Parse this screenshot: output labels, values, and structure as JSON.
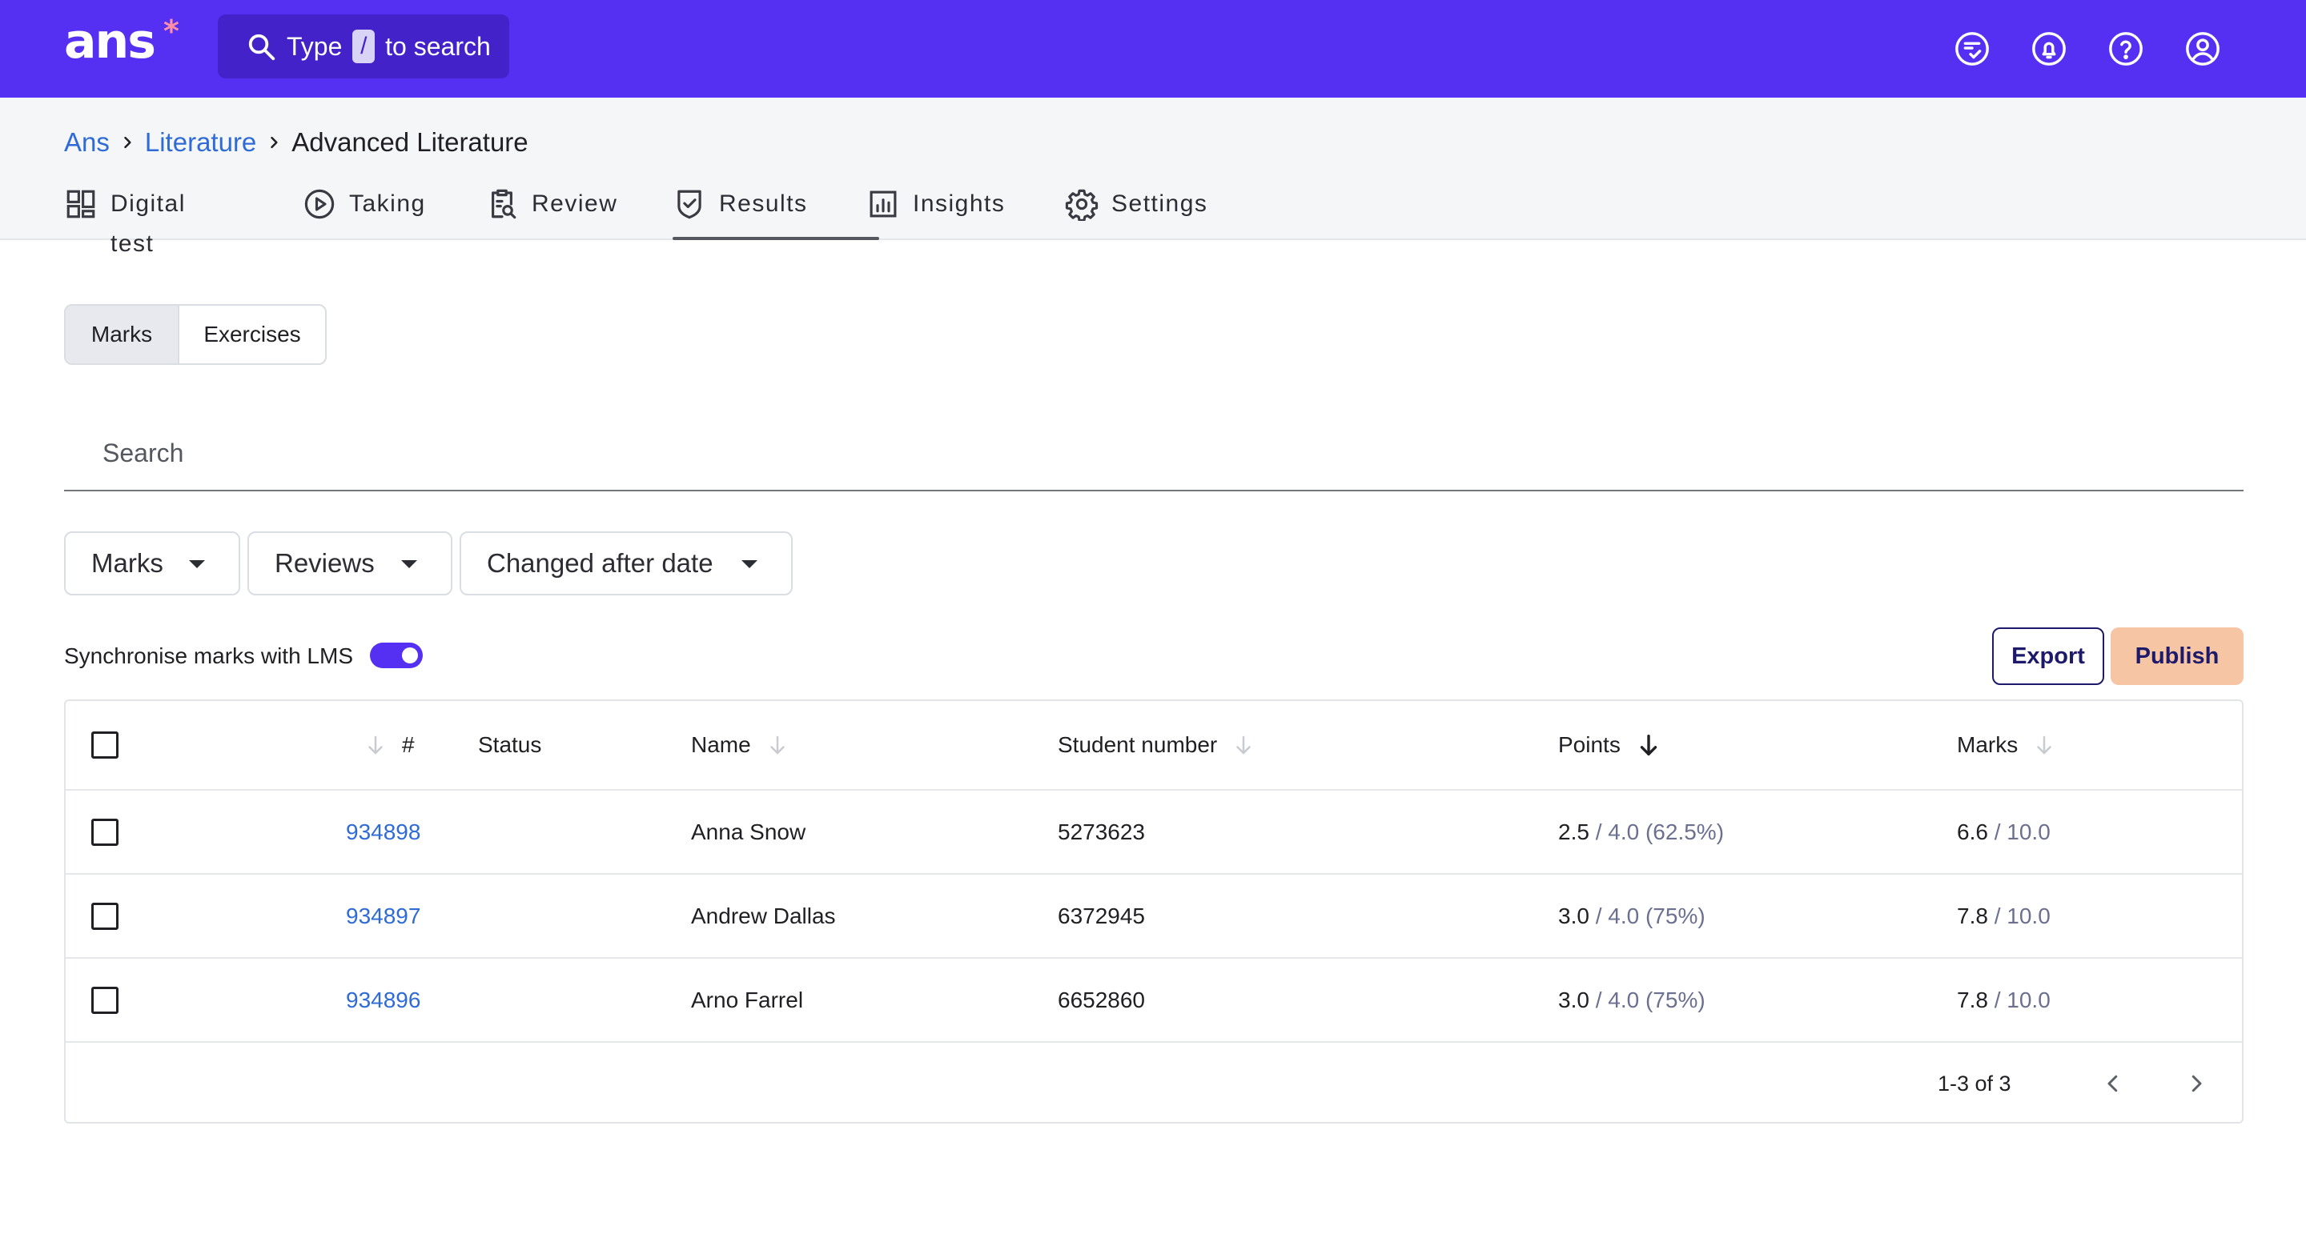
{
  "header": {
    "logo_text": "ans",
    "logo_mark": "*",
    "search": {
      "prefix": "Type",
      "key": "/",
      "suffix": "to search"
    },
    "icons": [
      "reviews-icon",
      "notifications-icon",
      "help-icon",
      "account-icon"
    ]
  },
  "breadcrumb": {
    "root": "Ans",
    "parent": "Literature",
    "current": "Advanced Literature"
  },
  "tabs": [
    {
      "label": "Digital test",
      "icon": "dashboard-icon"
    },
    {
      "label": "Taking",
      "icon": "play-circle-icon"
    },
    {
      "label": "Review",
      "icon": "clipboard-search-icon"
    },
    {
      "label": "Results",
      "icon": "shield-check-icon",
      "active": true
    },
    {
      "label": "Insights",
      "icon": "bar-chart-icon"
    },
    {
      "label": "Settings",
      "icon": "gear-icon"
    }
  ],
  "segment": {
    "active": "Marks",
    "other": "Exercises"
  },
  "search": {
    "placeholder": "Search"
  },
  "filters": [
    "Marks",
    "Reviews",
    "Changed after date"
  ],
  "sync": {
    "label": "Synchronise marks with LMS",
    "enabled": true
  },
  "actions": {
    "export": "Export",
    "publish": "Publish"
  },
  "table": {
    "columns": {
      "id": "#",
      "status": "Status",
      "name": "Name",
      "student_number": "Student number",
      "points": "Points",
      "marks": "Marks"
    },
    "rows": [
      {
        "id": "934898",
        "status": "",
        "name": "Anna Snow",
        "student_number": "5273623",
        "points": "2.5",
        "points_total": "/ 4.0 (62.5%)",
        "mark": "6.6",
        "mark_total": "/ 10.0"
      },
      {
        "id": "934897",
        "status": "",
        "name": "Andrew Dallas",
        "student_number": "6372945",
        "points": "3.0",
        "points_total": "/ 4.0 (75%)",
        "mark": "7.8",
        "mark_total": "/ 10.0"
      },
      {
        "id": "934896",
        "status": "",
        "name": "Arno Farrel",
        "student_number": "6652860",
        "points": "3.0",
        "points_total": "/ 4.0 (75%)",
        "mark": "7.8",
        "mark_total": "/ 10.0"
      }
    ],
    "pagination": "1-3 of 3"
  },
  "colors": {
    "brand": "#5530f2",
    "link": "#2f6bd6",
    "publish": "#f6c6a4",
    "navy": "#1e1a6b"
  }
}
